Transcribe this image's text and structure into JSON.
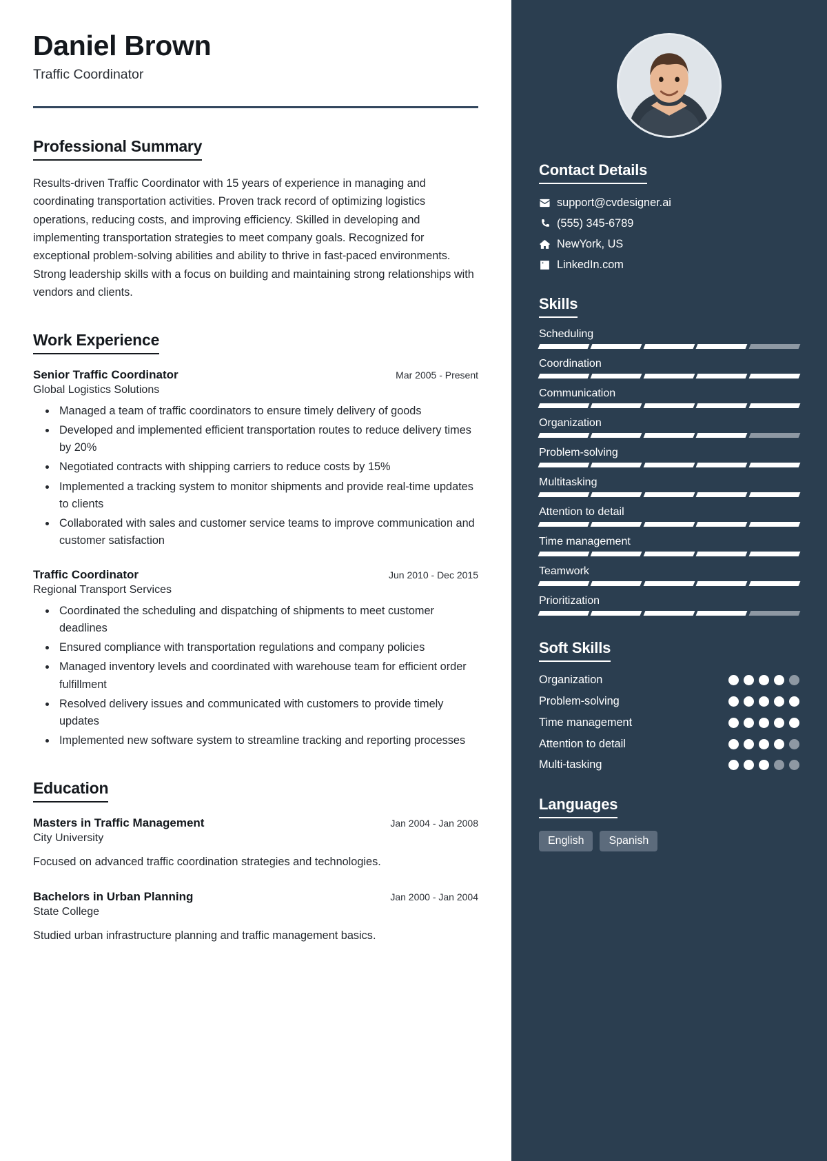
{
  "profile": {
    "name": "Daniel Brown",
    "title": "Traffic Coordinator",
    "avatar_icon": "user-photo"
  },
  "theme": {
    "sidebar_bg": "#2b3e50",
    "accent_rule": "#33475e",
    "chip_bg": "#5c6b7c",
    "empty_segment": "#8e98a3"
  },
  "main": {
    "summary": {
      "heading": "Professional Summary",
      "text": "Results-driven Traffic Coordinator with 15 years of experience in managing and coordinating transportation activities. Proven track record of optimizing logistics operations, reducing costs, and improving efficiency. Skilled in developing and implementing transportation strategies to meet company goals. Recognized for exceptional problem-solving abilities and ability to thrive in fast-paced environments. Strong leadership skills with a focus on building and maintaining strong relationships with vendors and clients."
    },
    "work": {
      "heading": "Work Experience",
      "entries": [
        {
          "role": "Senior Traffic Coordinator",
          "dates": "Mar 2005 - Present",
          "org": "Global Logistics Solutions",
          "bullets": [
            "Managed a team of traffic coordinators to ensure timely delivery of goods",
            "Developed and implemented efficient transportation routes to reduce delivery times by 20%",
            "Negotiated contracts with shipping carriers to reduce costs by 15%",
            "Implemented a tracking system to monitor shipments and provide real-time updates to clients",
            "Collaborated with sales and customer service teams to improve communication and customer satisfaction"
          ]
        },
        {
          "role": "Traffic Coordinator",
          "dates": "Jun 2010 - Dec 2015",
          "org": "Regional Transport Services",
          "bullets": [
            "Coordinated the scheduling and dispatching of shipments to meet customer deadlines",
            "Ensured compliance with transportation regulations and company policies",
            "Managed inventory levels and coordinated with warehouse team for efficient order fulfillment",
            "Resolved delivery issues and communicated with customers to provide timely updates",
            "Implemented new software system to streamline tracking and reporting processes"
          ]
        }
      ]
    },
    "education": {
      "heading": "Education",
      "entries": [
        {
          "degree": "Masters in Traffic Management",
          "dates": "Jan 2004 - Jan 2008",
          "school": "City University",
          "description": "Focused on advanced traffic coordination strategies and technologies."
        },
        {
          "degree": "Bachelors in Urban Planning",
          "dates": "Jan 2000 - Jan 2004",
          "school": "State College",
          "description": "Studied urban infrastructure planning and traffic management basics."
        }
      ]
    }
  },
  "sidebar": {
    "contact": {
      "heading": "Contact Details",
      "items": [
        {
          "icon": "envelope-icon",
          "value": "support@cvdesigner.ai"
        },
        {
          "icon": "phone-icon",
          "value": "(555) 345-6789"
        },
        {
          "icon": "home-icon",
          "value": "NewYork, US"
        },
        {
          "icon": "linkedin-icon",
          "value": "LinkedIn.com"
        }
      ]
    },
    "skills": {
      "heading": "Skills",
      "max": 5,
      "items": [
        {
          "name": "Scheduling",
          "level": 4
        },
        {
          "name": "Coordination",
          "level": 5
        },
        {
          "name": "Communication",
          "level": 5
        },
        {
          "name": "Organization",
          "level": 4
        },
        {
          "name": "Problem-solving",
          "level": 5
        },
        {
          "name": "Multitasking",
          "level": 5
        },
        {
          "name": "Attention to detail",
          "level": 5
        },
        {
          "name": "Time management",
          "level": 5
        },
        {
          "name": "Teamwork",
          "level": 5
        },
        {
          "name": "Prioritization",
          "level": 4
        }
      ]
    },
    "soft_skills": {
      "heading": "Soft Skills",
      "max": 5,
      "items": [
        {
          "name": "Organization",
          "level": 4
        },
        {
          "name": "Problem-solving",
          "level": 5
        },
        {
          "name": "Time management",
          "level": 5
        },
        {
          "name": "Attention to detail",
          "level": 4
        },
        {
          "name": "Multi-tasking",
          "level": 3
        }
      ]
    },
    "languages": {
      "heading": "Languages",
      "items": [
        "English",
        "Spanish"
      ]
    }
  }
}
